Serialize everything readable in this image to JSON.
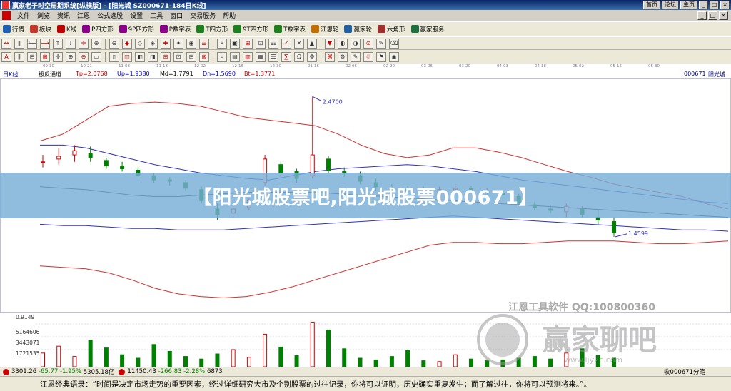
{
  "window": {
    "title": "赢家老子时空周期系统[纵横版] - [阳光城  SZ000671-184日K线]",
    "buttons": [
      "首页",
      "论坛",
      "主页"
    ],
    "win_controls": [
      "_",
      "□",
      "×"
    ]
  },
  "menu": {
    "items": [
      "文件",
      "浏览",
      "资讯",
      "江恩",
      "公式选股",
      "设置",
      "工具",
      "窗口",
      "交易服务",
      "帮助"
    ]
  },
  "toolbar1": {
    "items": [
      {
        "label": "行情",
        "color": "#1e5fb4"
      },
      {
        "label": "板块",
        "color": "#c0392b"
      },
      {
        "label": "K线",
        "color": "#c00000"
      },
      {
        "label": "P四方形",
        "color": "#8b008b"
      },
      {
        "label": "9P四方形",
        "color": "#8b008b"
      },
      {
        "label": "P数字表",
        "color": "#8b008b"
      },
      {
        "label": "T四方形",
        "color": "#1e7f1e"
      },
      {
        "label": "9T四方形",
        "color": "#1e7f1e"
      },
      {
        "label": "T数字表",
        "color": "#1e7f1e"
      },
      {
        "label": "江恩轮",
        "color": "#c07000"
      },
      {
        "label": "赢家轮",
        "color": "#2060a0"
      },
      {
        "label": "六角形",
        "color": "#a03030"
      },
      {
        "label": "赢家服务",
        "color": "#207040"
      }
    ]
  },
  "toolbar2": {
    "icons": [
      "↔",
      "ǁ",
      "⟵",
      "⟶",
      "↑",
      "↓",
      "✛",
      "⊕",
      "⊖",
      "◆",
      "◇",
      "◈",
      "✚",
      "✦",
      "◉",
      "☰",
      "⌖",
      "▣",
      "⊞",
      "⊡",
      "☷",
      "✓",
      "✕",
      "▲",
      "▼",
      "◐",
      "◑",
      "⊙",
      "✎",
      "⌫"
    ]
  },
  "toolbar3": {
    "icons": [
      "A",
      "ǁ",
      "⊟",
      "⊠",
      "✛",
      "⊕",
      "⊖",
      "▭",
      "▯",
      "◫",
      "◧",
      "◨",
      "⊞",
      "⊡",
      "⊟",
      "⊠",
      "⌗",
      "▤",
      "▥",
      "▦",
      "☰",
      "∑",
      "Ω",
      "Φ",
      "⌘",
      "⚙",
      "✎",
      "♲",
      "⚑",
      "◉"
    ]
  },
  "date_axis": [
    "09-30",
    "10-21",
    "11-08",
    "11-18",
    "12-02",
    "12-16",
    "12-30",
    "01-16",
    "02-06",
    "02-20",
    "03-06",
    "03-20",
    "04-03",
    "04-18",
    "05-02",
    "05-16",
    "05-30"
  ],
  "chart_header": {
    "period_label": "日K线",
    "indicator": "极反通道",
    "tp": "Tp=2.0768",
    "up": "Up=1.9380",
    "md": "Md=1.7791",
    "dn": "Dn=1.5690",
    "bt": "Bt=1.3771",
    "stock_code": "000671",
    "stock_name": "阳光城",
    "colors": {
      "tp": "#c00000",
      "up": "#0000c0",
      "md": "#000000",
      "dn": "#0000c0",
      "bt": "#c00000"
    }
  },
  "annotations": {
    "high": "2.4700",
    "low": "1.4599"
  },
  "volume_axis": {
    "labels": [
      "0.9149",
      "5164606",
      "3443071",
      "1721535"
    ]
  },
  "watermark": {
    "line1": "江恩工具软件  QQ:100800360",
    "brand": "赢家聊吧",
    "url": "www.ljy2c.com"
  },
  "banner": {
    "text": "【阳光城股票吧,阳光城股票000671】"
  },
  "statusbar": {
    "sh_index": "3301.26",
    "sh_change": "-65.77",
    "sh_pct": "-1.95%",
    "sh_amount": "5305.18亿",
    "sz_index": "11450.43",
    "sz_change": "-266.83",
    "sz_pct": "-2.28%",
    "sz_amount": "6873",
    "right_label": "收000671分笔"
  },
  "quote": {
    "text": "江恩经典语录：“时间是决定市场走势的重要因素，经过详细研究大市及个别股票的过往记录，你将可以证明，历史确实重复发生；而了解过往，你将可以预测将来。”。"
  },
  "chart_data": {
    "type": "candlestick",
    "title": "",
    "ylim": [
      0.9149,
      2.6
    ],
    "tp_band": [
      2.15,
      2.2,
      2.3,
      2.4,
      2.42,
      2.43,
      2.42,
      2.4,
      2.36,
      2.32,
      2.3,
      2.28,
      2.26,
      2.2,
      2.12,
      2.06,
      2.03,
      2.05,
      2.1,
      2.1,
      2.07,
      2.03,
      1.98,
      1.93,
      1.89,
      1.84,
      1.81,
      1.78,
      1.75,
      1.7,
      1.66
    ],
    "up_band": [
      2.12,
      2.12,
      2.1,
      2.06,
      2.02,
      1.98,
      1.95,
      1.92,
      1.9,
      1.88,
      1.87,
      1.9,
      1.93,
      1.95,
      1.96,
      1.97,
      1.98,
      1.97,
      1.95,
      1.93,
      1.9,
      1.87,
      1.85,
      1.83,
      1.81,
      1.79,
      1.77,
      1.75,
      1.73,
      1.71,
      1.7
    ],
    "md_band": [
      1.82,
      1.81,
      1.8,
      1.78,
      1.76,
      1.75,
      1.75,
      1.76,
      1.77,
      1.78,
      1.78,
      1.78,
      1.78,
      1.77,
      1.76,
      1.75,
      1.74,
      1.73,
      1.72,
      1.71,
      1.7,
      1.69,
      1.68,
      1.67,
      1.66,
      1.65,
      1.64,
      1.63,
      1.62,
      1.61,
      1.6
    ],
    "dn_band": [
      1.55,
      1.54,
      1.54,
      1.53,
      1.52,
      1.52,
      1.51,
      1.51,
      1.51,
      1.52,
      1.53,
      1.54,
      1.55,
      1.56,
      1.57,
      1.58,
      1.59,
      1.6,
      1.61,
      1.6,
      1.59,
      1.58,
      1.57,
      1.56,
      1.55,
      1.54,
      1.53,
      1.52,
      1.51,
      1.51,
      1.5
    ],
    "bt_band": [
      1.25,
      1.24,
      1.23,
      1.2,
      1.15,
      1.09,
      1.05,
      1.03,
      1.02,
      1.03,
      1.06,
      1.1,
      1.15,
      1.2,
      1.25,
      1.3,
      1.35,
      1.4,
      1.42,
      1.42,
      1.41,
      1.41,
      1.42,
      1.43,
      1.43,
      1.43,
      1.42,
      1.41,
      1.41,
      1.42,
      1.43
    ],
    "candles": [
      {
        "o": 2.0,
        "h": 2.05,
        "l": 1.96,
        "c": 2.0
      },
      {
        "o": 2.02,
        "h": 2.1,
        "l": 1.98,
        "c": 2.04
      },
      {
        "o": 2.05,
        "h": 2.12,
        "l": 2.0,
        "c": 2.08
      },
      {
        "o": 2.06,
        "h": 2.11,
        "l": 2.0,
        "c": 2.03
      },
      {
        "o": 2.01,
        "h": 2.03,
        "l": 1.95,
        "c": 1.97
      },
      {
        "o": 1.97,
        "h": 2.0,
        "l": 1.93,
        "c": 1.95
      },
      {
        "o": 1.94,
        "h": 1.96,
        "l": 1.88,
        "c": 1.9
      },
      {
        "o": 1.9,
        "h": 1.92,
        "l": 1.85,
        "c": 1.87
      },
      {
        "o": 1.87,
        "h": 1.89,
        "l": 1.83,
        "c": 1.86
      },
      {
        "o": 1.85,
        "h": 1.87,
        "l": 1.79,
        "c": 1.81
      },
      {
        "o": 1.8,
        "h": 1.82,
        "l": 1.7,
        "c": 1.72
      },
      {
        "o": 1.66,
        "h": 1.7,
        "l": 1.58,
        "c": 1.62
      },
      {
        "o": 1.63,
        "h": 1.68,
        "l": 1.6,
        "c": 1.66
      },
      {
        "o": 1.67,
        "h": 1.74,
        "l": 1.65,
        "c": 1.72
      },
      {
        "o": 1.85,
        "h": 2.05,
        "l": 1.83,
        "c": 2.02
      },
      {
        "o": 1.98,
        "h": 2.0,
        "l": 1.9,
        "c": 1.92
      },
      {
        "o": 1.93,
        "h": 1.95,
        "l": 1.85,
        "c": 1.88
      },
      {
        "o": 1.9,
        "h": 2.47,
        "l": 1.88,
        "c": 2.05
      },
      {
        "o": 2.02,
        "h": 2.04,
        "l": 1.92,
        "c": 1.94
      },
      {
        "o": 1.93,
        "h": 1.96,
        "l": 1.89,
        "c": 1.92
      },
      {
        "o": 1.9,
        "h": 1.93,
        "l": 1.84,
        "c": 1.86
      },
      {
        "o": 1.85,
        "h": 1.88,
        "l": 1.79,
        "c": 1.82
      },
      {
        "o": 1.81,
        "h": 1.84,
        "l": 1.78,
        "c": 1.8
      },
      {
        "o": 1.8,
        "h": 1.83,
        "l": 1.77,
        "c": 1.79
      },
      {
        "o": 1.79,
        "h": 1.82,
        "l": 1.76,
        "c": 1.78
      },
      {
        "o": 1.78,
        "h": 1.82,
        "l": 1.76,
        "c": 1.8
      },
      {
        "o": 1.8,
        "h": 1.84,
        "l": 1.78,
        "c": 1.81
      },
      {
        "o": 1.81,
        "h": 1.83,
        "l": 1.78,
        "c": 1.79
      },
      {
        "o": 1.79,
        "h": 1.81,
        "l": 1.76,
        "c": 1.78
      },
      {
        "o": 1.77,
        "h": 1.8,
        "l": 1.74,
        "c": 1.76
      },
      {
        "o": 1.75,
        "h": 1.77,
        "l": 1.69,
        "c": 1.7
      },
      {
        "o": 1.69,
        "h": 1.71,
        "l": 1.65,
        "c": 1.67
      },
      {
        "o": 1.66,
        "h": 1.69,
        "l": 1.63,
        "c": 1.65
      },
      {
        "o": 1.64,
        "h": 1.7,
        "l": 1.6,
        "c": 1.68
      },
      {
        "o": 1.66,
        "h": 1.68,
        "l": 1.6,
        "c": 1.62
      },
      {
        "o": 1.6,
        "h": 1.65,
        "l": 1.55,
        "c": 1.58
      },
      {
        "o": 1.57,
        "h": 1.6,
        "l": 1.46,
        "c": 1.49
      }
    ],
    "volume": [
      1.6,
      2.4,
      1.2,
      3.1,
      2.2,
      1.4,
      1.0,
      2.6,
      1.8,
      1.2,
      0.9,
      1.5,
      2.0,
      1.1,
      3.8,
      2.3,
      1.3,
      5.2,
      4.3,
      2.1,
      1.0,
      0.8,
      1.2,
      1.9,
      0.7,
      0.6,
      1.4,
      0.9,
      0.7,
      0.8,
      1.0,
      1.2,
      0.9,
      1.6,
      2.1,
      1.3,
      1.0
    ],
    "volume_ylim": [
      0,
      6.0
    ]
  }
}
